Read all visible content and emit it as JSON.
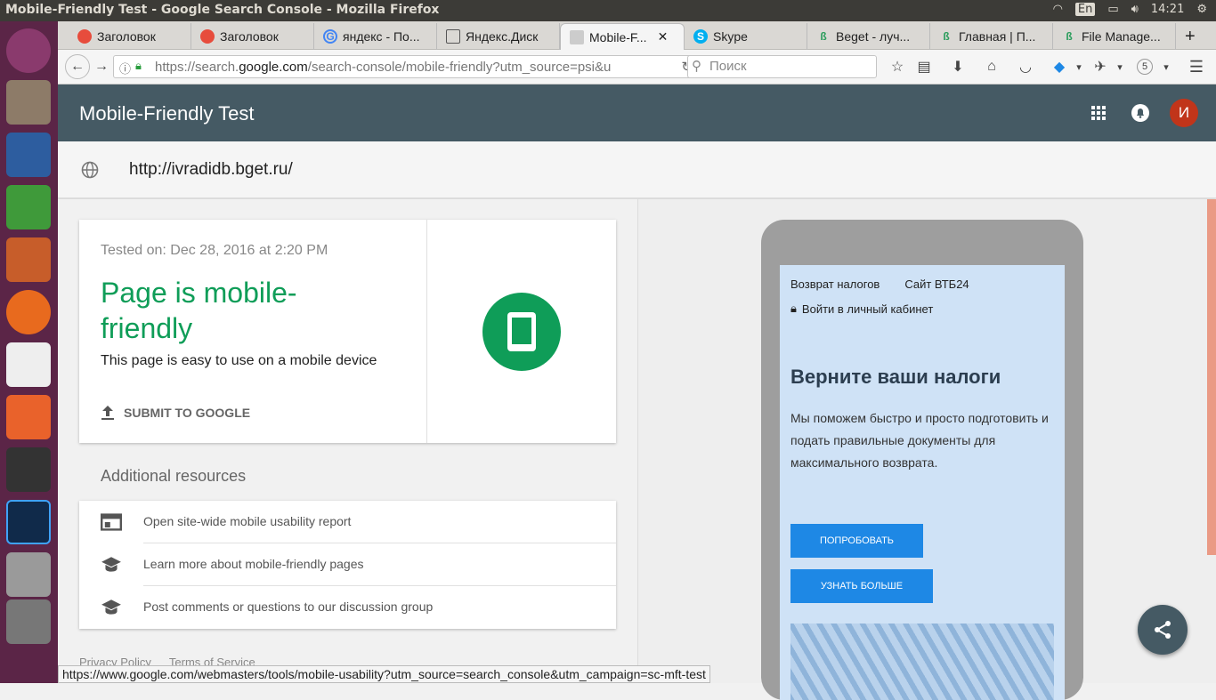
{
  "os": {
    "window_title": "Mobile-Friendly Test - Google Search Console - Mozilla Firefox",
    "lang": "En",
    "time": "14:21"
  },
  "tabs": [
    {
      "label": "Заголовок"
    },
    {
      "label": "Заголовок"
    },
    {
      "label": "яндекс - По..."
    },
    {
      "label": "Яндекс.Диск"
    },
    {
      "label": "Mobile-F..."
    },
    {
      "label": "Skype"
    },
    {
      "label": "Beget - луч..."
    },
    {
      "label": "Главная | П..."
    },
    {
      "label": "File Manage..."
    }
  ],
  "nav": {
    "url_prefix": "https://search.",
    "url_domain": "google.com",
    "url_suffix": "/search-console/mobile-friendly?utm_source=psi&u",
    "search_placeholder": "Поиск",
    "badge_count": "5"
  },
  "app": {
    "title": "Mobile-Friendly Test",
    "avatar_letter": "И"
  },
  "tested_url": "http://ivradidb.bget.ru/",
  "result": {
    "tested_on": "Tested on: Dec 28, 2016 at 2:20 PM",
    "headline": "Page is mobile-friendly",
    "description": "This page is easy to use on a mobile device",
    "submit_label": "SUBMIT TO GOOGLE"
  },
  "resources": {
    "title": "Additional resources",
    "items": [
      {
        "label": "Open site-wide mobile usability report"
      },
      {
        "label": "Learn more about mobile-friendly pages"
      },
      {
        "label": "Post comments or questions to our discussion group"
      }
    ]
  },
  "footer": {
    "privacy": "Privacy Policy",
    "terms": "Terms of Service"
  },
  "preview": {
    "nav1": "Возврат налогов",
    "nav2": "Сайт ВТБ24",
    "login": "Войти в личный кабинет",
    "heading": "Верните ваши налоги",
    "body": "Мы поможем быстро и просто подготовить и подать правильные документы для максимального возврата.",
    "btn_try": "ПОПРОБОВАТЬ",
    "btn_more": "УЗНАТЬ БОЛЬШЕ"
  },
  "statusbar": "https://www.google.com/webmasters/tools/mobile-usability?utm_source=search_console&utm_campaign=sc-mft-test",
  "colors": {
    "appbar": "#455a64",
    "success": "#0f9d58",
    "button": "#1e88e5"
  }
}
